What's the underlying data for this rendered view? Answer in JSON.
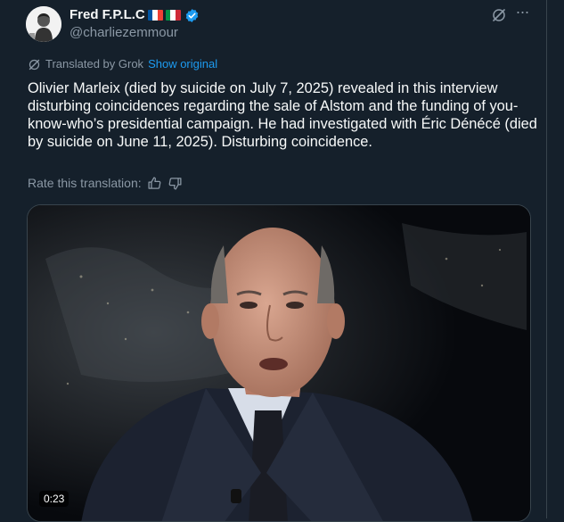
{
  "author": {
    "display_name": "Fred F.P.L.C",
    "handle": "@charliezemmour",
    "avatar_icon": "avatar-photo",
    "flags": [
      "france-flag-icon",
      "italy-flag-icon"
    ],
    "verified_icon": "verified-badge-icon"
  },
  "actions": {
    "grok_icon": "grok-icon",
    "more_icon": "more-icon"
  },
  "translation": {
    "label": "Translated by Grok",
    "show_original": "Show original"
  },
  "tweet": {
    "text": "Olivier Marleix (died by suicide on July 7, 2025) revealed in this interview disturbing coincidences regarding the sale of Alstom and the funding of you-know-who’s presidential campaign. He had investigated with Éric Dénécé (died by suicide on June 11, 2025). Disturbing coincidence."
  },
  "rating": {
    "label": "Rate this translation:",
    "thumbs_up_icon": "thumbs-up-icon",
    "thumbs_down_icon": "thumbs-down-icon"
  },
  "media": {
    "duration": "0:23"
  },
  "colors": {
    "background": "#15202b",
    "text_primary": "#f7f9f9",
    "text_secondary": "#8b98a5",
    "link": "#1d9bf0",
    "border": "#38444d"
  }
}
